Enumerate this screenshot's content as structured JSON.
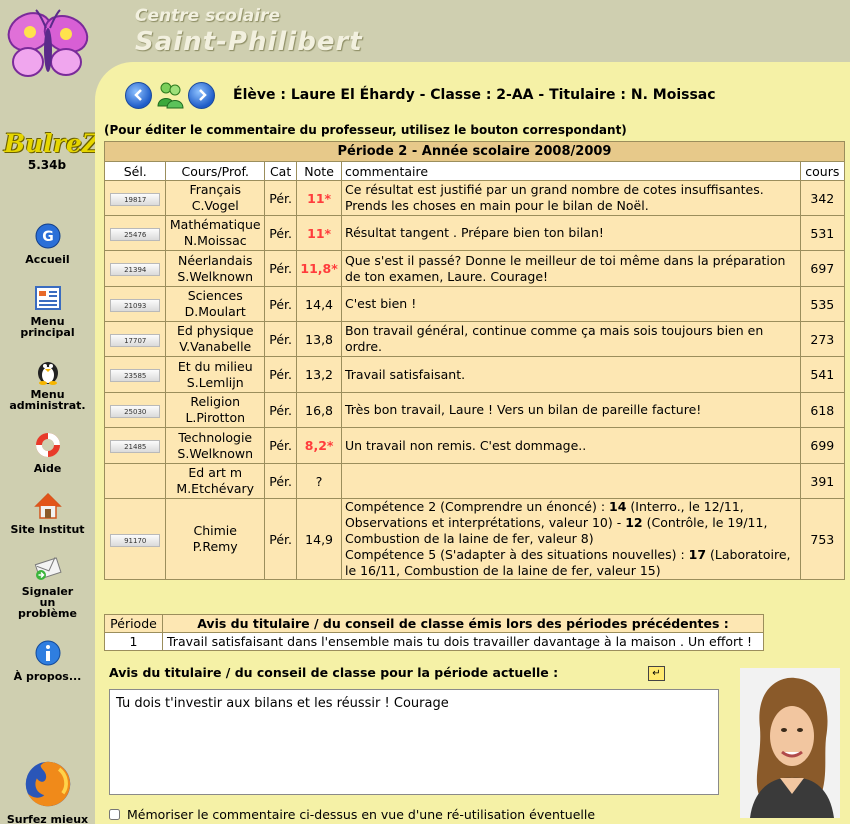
{
  "site": {
    "title_line1": "Centre scolaire",
    "title_line2": "Saint-Philibert"
  },
  "app": {
    "name": "BulreZo",
    "version": "5.34b"
  },
  "nav": [
    {
      "label": "Accueil",
      "icon": "google-icon"
    },
    {
      "label": "Menu principal",
      "icon": "menu-grid-icon"
    },
    {
      "label": "Menu administrat.",
      "icon": "penguin-icon"
    },
    {
      "label": "Aide",
      "icon": "lifebuoy-icon"
    },
    {
      "label": "Site Institut",
      "icon": "home-icon"
    },
    {
      "label": "Signaler un problème",
      "icon": "mail-icon"
    },
    {
      "label": "À propos...",
      "icon": "info-icon"
    },
    {
      "label": "Surfez mieux",
      "icon": "firefox-icon"
    }
  ],
  "header": {
    "student_line": "Élève : Laure El Éhardy - Classe : 2-AA - Titulaire : N. Moissac"
  },
  "instructions": "(Pour éditer le commentaire du professeur, utilisez le bouton correspondant)",
  "grades": {
    "period_title": "Période 2 - Année scolaire 2008/2009",
    "headers": {
      "sel": "Sél.",
      "course": "Cours/Prof.",
      "cat": "Cat",
      "note": "Note",
      "comment": "commentaire",
      "cours": "cours"
    },
    "rows": [
      {
        "sel": "19817",
        "course": "Français",
        "prof": "C.Vogel",
        "cat": "Pér.",
        "note": "11*",
        "red": true,
        "comment": "Ce résultat est justifié par un grand nombre de cotes insuffisantes. Prends les choses en main pour le bilan de Noël.",
        "cours": "342"
      },
      {
        "sel": "25476",
        "course": "Mathématique",
        "prof": "N.Moissac",
        "cat": "Pér.",
        "note": "11*",
        "red": true,
        "comment": "Résultat tangent . Prépare bien ton bilan!",
        "cours": "531"
      },
      {
        "sel": "21394",
        "course": "Néerlandais",
        "prof": "S.Welknown",
        "cat": "Pér.",
        "note": "11,8*",
        "red": true,
        "comment": "Que s'est il passé? Donne le meilleur de toi même dans la préparation de ton examen, Laure. Courage!",
        "cours": "697"
      },
      {
        "sel": "21093",
        "course": "Sciences",
        "prof": "D.Moulart",
        "cat": "Pér.",
        "note": "14,4",
        "red": false,
        "comment": "C'est bien !",
        "cours": "535"
      },
      {
        "sel": "17707",
        "course": "Ed physique",
        "prof": "V.Vanabelle",
        "cat": "Pér.",
        "note": "13,8",
        "red": false,
        "comment": "Bon travail général, continue comme ça mais sois toujours bien en ordre.",
        "cours": "273"
      },
      {
        "sel": "23585",
        "course": "Et du milieu",
        "prof": "S.Lemlijn",
        "cat": "Pér.",
        "note": "13,2",
        "red": false,
        "comment": "Travail satisfaisant.",
        "cours": "541"
      },
      {
        "sel": "25030",
        "course": "Religion",
        "prof": "L.Pirotton",
        "cat": "Pér.",
        "note": "16,8",
        "red": false,
        "comment": "Très bon travail, Laure ! Vers un bilan de pareille facture!",
        "cours": "618"
      },
      {
        "sel": "21485",
        "course": "Technologie",
        "prof": "S.Welknown",
        "cat": "Pér.",
        "note": "8,2*",
        "red": true,
        "comment": "Un travail non remis. C'est dommage..",
        "cours": "699"
      },
      {
        "sel": "",
        "course": "Ed art m",
        "prof": "M.Etchévary",
        "cat": "Pér.",
        "note": "?",
        "red": false,
        "comment": "",
        "cours": "391"
      },
      {
        "sel": "91170",
        "course": "Chimie",
        "prof": "P.Remy",
        "cat": "Pér.",
        "note": "14,9",
        "red": false,
        "cours": "753",
        "rich": [
          {
            "t": "Compétence 2 (Comprendre un énoncé) : "
          },
          {
            "t": "14",
            "b": true
          },
          {
            "t": " (Interro., le 12/11, Observations et interprétations, valeur 10) - "
          },
          {
            "t": "12",
            "b": true
          },
          {
            "t": " (Contrôle, le 19/11, Combustion de la laine de fer, valeur 8)",
            "br": true
          },
          {
            "t": "Compétence 5 (S'adapter à des situations nouvelles) : "
          },
          {
            "t": "17",
            "b": true
          },
          {
            "t": " (Laboratoire, le 16/11, Combustion de la laine de fer, valeur 15)"
          }
        ]
      }
    ]
  },
  "previous": {
    "header_period": "Période",
    "header_avis": "Avis du titulaire / du conseil de classe émis lors des périodes précédentes :",
    "rows": [
      {
        "period": "1",
        "avis": "Travail satisfaisant dans l'ensemble mais tu dois travailler davantage à la maison . Un effort !"
      }
    ]
  },
  "avis": {
    "label": "Avis du titulaire / du conseil de classe pour la période actuelle :",
    "text": "Tu dois t'investir aux bilans et les réussir ! Courage"
  },
  "memo_label": "Mémoriser le commentaire ci-dessus en vue d'une ré-utilisation éventuelle"
}
